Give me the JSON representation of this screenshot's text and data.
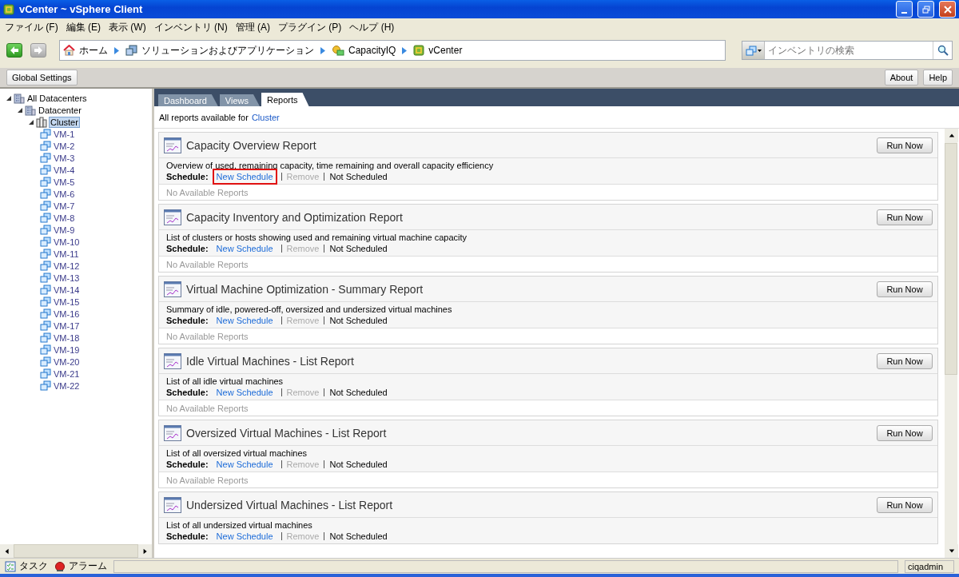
{
  "window": {
    "title": "vCenter ~ vSphere Client"
  },
  "menu": [
    "ファイル (F)",
    "編集 (E)",
    "表示 (W)",
    "インベントリ (N)",
    "管理 (A)",
    "プラグイン (P)",
    "ヘルプ (H)"
  ],
  "nav": {
    "back": {
      "disabled": false
    },
    "forward": {
      "disabled": true
    }
  },
  "breadcrumbs": [
    {
      "kind": "home",
      "label": "ホーム"
    },
    {
      "kind": "solutions",
      "label": "ソリューションおよびアプリケーション"
    },
    {
      "kind": "capacityiq",
      "label": "CapacityIQ"
    },
    {
      "kind": "vcenter",
      "label": "vCenter"
    }
  ],
  "search": {
    "placeholder": "インベントリの検索"
  },
  "toolbar": {
    "left": [
      "Global Settings"
    ],
    "right": [
      "About",
      "Help"
    ]
  },
  "tree": [
    {
      "label": "All Datacenters",
      "kind": "datacenters",
      "expanded": true,
      "selected": false,
      "children": [
        {
          "label": "Datacenter",
          "kind": "datacenter",
          "expanded": true,
          "selected": false,
          "children": [
            {
              "label": "Cluster",
              "kind": "cluster",
              "expanded": true,
              "selected": true,
              "children": [
                {
                  "label": "VM-1",
                  "kind": "vm",
                  "selected": false
                },
                {
                  "label": "VM-2",
                  "kind": "vm",
                  "selected": false
                },
                {
                  "label": "VM-3",
                  "kind": "vm",
                  "selected": false
                },
                {
                  "label": "VM-4",
                  "kind": "vm",
                  "selected": false
                },
                {
                  "label": "VM-5",
                  "kind": "vm",
                  "selected": false
                },
                {
                  "label": "VM-6",
                  "kind": "vm",
                  "selected": false
                },
                {
                  "label": "VM-7",
                  "kind": "vm",
                  "selected": false
                },
                {
                  "label": "VM-8",
                  "kind": "vm",
                  "selected": false
                },
                {
                  "label": "VM-9",
                  "kind": "vm",
                  "selected": false
                },
                {
                  "label": "VM-10",
                  "kind": "vm",
                  "selected": false
                },
                {
                  "label": "VM-11",
                  "kind": "vm",
                  "selected": false
                },
                {
                  "label": "VM-12",
                  "kind": "vm",
                  "selected": false
                },
                {
                  "label": "VM-13",
                  "kind": "vm",
                  "selected": false
                },
                {
                  "label": "VM-14",
                  "kind": "vm",
                  "selected": false
                },
                {
                  "label": "VM-15",
                  "kind": "vm",
                  "selected": false
                },
                {
                  "label": "VM-16",
                  "kind": "vm",
                  "selected": false
                },
                {
                  "label": "VM-17",
                  "kind": "vm",
                  "selected": false
                },
                {
                  "label": "VM-18",
                  "kind": "vm",
                  "selected": false
                },
                {
                  "label": "VM-19",
                  "kind": "vm",
                  "selected": false
                },
                {
                  "label": "VM-20",
                  "kind": "vm",
                  "selected": false
                },
                {
                  "label": "VM-21",
                  "kind": "vm",
                  "selected": false
                },
                {
                  "label": "VM-22",
                  "kind": "vm",
                  "selected": false
                }
              ]
            }
          ]
        }
      ]
    }
  ],
  "tabs": [
    {
      "label": "Dashboard",
      "selected": false
    },
    {
      "label": "Views",
      "selected": false
    },
    {
      "label": "Reports",
      "selected": true
    }
  ],
  "subtitle": {
    "text": "All reports available for",
    "target": "Cluster"
  },
  "reports": [
    {
      "title": "Capacity Overview Report",
      "description": "Overview of used, remaining capacity, time remaining and overall capacity efficiency",
      "schedule_label": "Schedule:",
      "new_schedule": "New Schedule",
      "highlighted": true,
      "remove": "Remove",
      "remove_disabled": true,
      "status": "Not Scheduled",
      "footer": "No Available Reports",
      "action": "Run Now"
    },
    {
      "title": "Capacity Inventory and Optimization Report",
      "description": "List of clusters or hosts showing used and remaining virtual machine capacity",
      "schedule_label": "Schedule:",
      "new_schedule": "New Schedule",
      "highlighted": false,
      "remove": "Remove",
      "remove_disabled": true,
      "status": "Not Scheduled",
      "footer": "No Available Reports",
      "action": "Run Now"
    },
    {
      "title": "Virtual Machine Optimization - Summary Report",
      "description": "Summary of idle, powered-off, oversized and undersized virtual machines",
      "schedule_label": "Schedule:",
      "new_schedule": "New Schedule",
      "highlighted": false,
      "remove": "Remove",
      "remove_disabled": true,
      "status": "Not Scheduled",
      "footer": "No Available Reports",
      "action": "Run Now"
    },
    {
      "title": "Idle Virtual Machines - List Report",
      "description": "List of all idle virtual machines",
      "schedule_label": "Schedule:",
      "new_schedule": "New Schedule",
      "highlighted": false,
      "remove": "Remove",
      "remove_disabled": true,
      "status": "Not Scheduled",
      "footer": "No Available Reports",
      "action": "Run Now"
    },
    {
      "title": "Oversized Virtual Machines - List Report",
      "description": "List of all oversized virtual machines",
      "schedule_label": "Schedule:",
      "new_schedule": "New Schedule",
      "highlighted": false,
      "remove": "Remove",
      "remove_disabled": true,
      "status": "Not Scheduled",
      "footer": "No Available Reports",
      "action": "Run Now"
    },
    {
      "title": "Undersized Virtual Machines - List Report",
      "description": "List of all undersized virtual machines",
      "schedule_label": "Schedule:",
      "new_schedule": "New Schedule",
      "highlighted": false,
      "remove": "Remove",
      "remove_disabled": true,
      "status": "Not Scheduled",
      "action": "Run Now"
    }
  ],
  "status_bar": {
    "items": [
      {
        "kind": "tasks",
        "label": "タスク"
      },
      {
        "kind": "alarms",
        "label": "アラーム"
      }
    ],
    "user": "ciqadmin"
  }
}
